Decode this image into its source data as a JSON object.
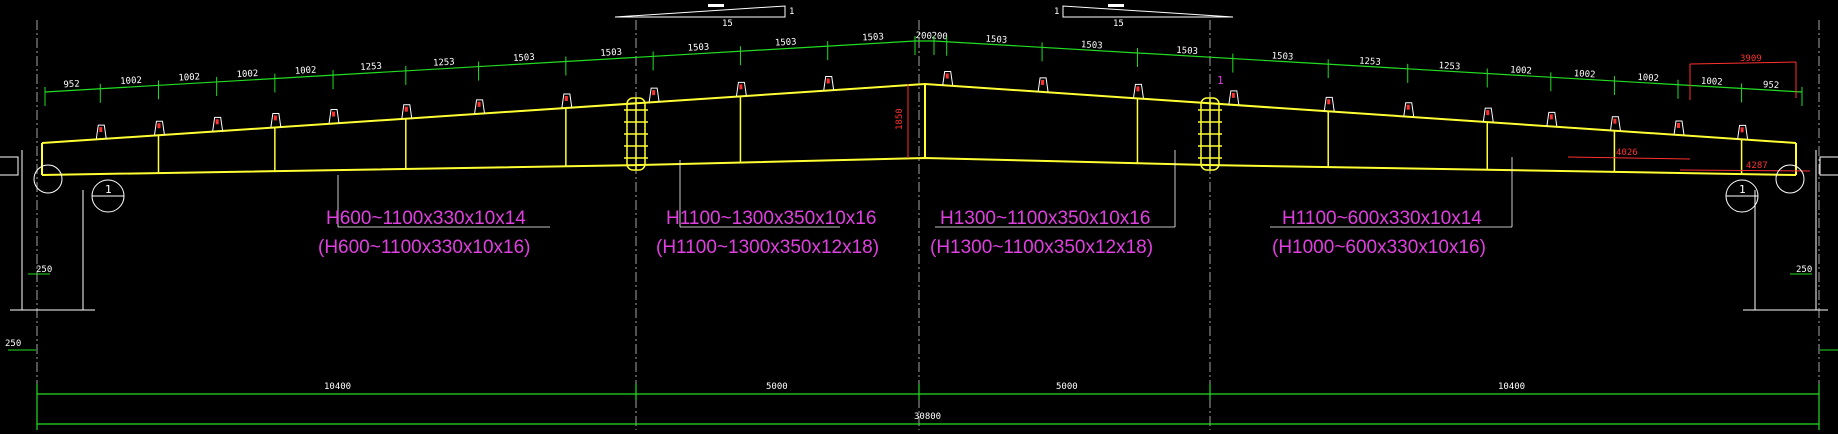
{
  "slope": {
    "left_run": "15",
    "left_rise": "1",
    "right_run": "15",
    "right_rise": "1"
  },
  "purlin_spacings": [
    "952",
    "1002",
    "1002",
    "1002",
    "1002",
    "1253",
    "1253",
    "1503",
    "1503",
    "1503",
    "1503",
    "1503",
    "200",
    "200",
    "1503",
    "1503",
    "1503",
    "1503",
    "1253",
    "1253",
    "1002",
    "1002",
    "1002",
    "1002",
    "952"
  ],
  "ridge_height": "1850",
  "section_mark": "1",
  "detail_red": {
    "top": "3909",
    "mid": "4026",
    "bottom": "4287"
  },
  "column_offset_left": "250",
  "column_offset_right": "250",
  "base_offset": "250",
  "bays": [
    "10400",
    "5000",
    "5000",
    "10400"
  ],
  "total_span": "30800",
  "members": [
    {
      "main": "H600~1100x330x10x14",
      "alt": "(H600~1100x330x10x16)"
    },
    {
      "main": "H1100~1300x350x10x16",
      "alt": "(H1100~1300x350x12x18)"
    },
    {
      "main": "H1300~1100x350x10x16",
      "alt": "(H1300~1100x350x12x18)"
    },
    {
      "main": "H1100~600x330x10x14",
      "alt": "(H1000~600x330x10x16)"
    }
  ],
  "colors": {
    "beam": "#ffff33",
    "dimension": "#22dd22",
    "label": "#e040e0",
    "red": "#ff3030",
    "line": "#ffffff"
  }
}
